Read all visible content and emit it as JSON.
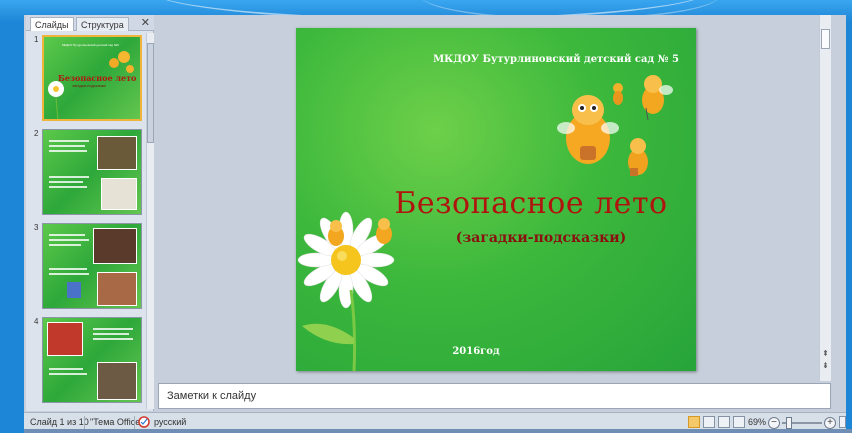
{
  "panel_tabs": {
    "slides": "Слайды",
    "outline": "Структура"
  },
  "thumbnails": [
    {
      "number": "1",
      "title": "Безопасное лето",
      "subtitle": "загадки-подсказки",
      "header": "МКДОУ Бутурлиновский детский сад №5"
    },
    {
      "number": "2"
    },
    {
      "number": "3"
    },
    {
      "number": "4"
    }
  ],
  "slide": {
    "header": "МКДОУ Бутурлиновский детский сад № 5",
    "title": "Безопасное лето",
    "subtitle": "(загадки-подсказки)",
    "footer": "2016год"
  },
  "notes_placeholder": "Заметки к слайду",
  "status": {
    "slide_counter": "Слайд 1 из 10",
    "theme": "\"Тема Office\"",
    "language": "русский",
    "zoom": "69%",
    "zoom_out": "−",
    "zoom_in": "+"
  },
  "icons": [
    "close-icon",
    "spellcheck-icon",
    "normal-view-icon",
    "slide-sorter-icon",
    "reading-view-icon",
    "slideshow-icon",
    "fit-window-icon"
  ],
  "colors": {
    "frame_blue": "#1e86d6",
    "slide_green": "#3cb83c",
    "title_red": "#b0140e",
    "selection": "#f0b43a"
  }
}
